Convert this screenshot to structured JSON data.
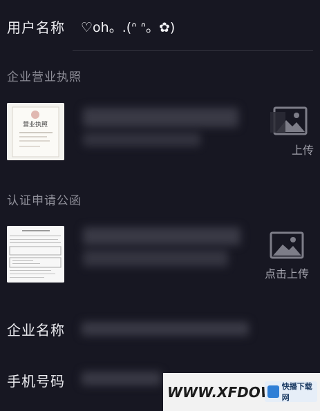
{
  "user": {
    "label": "用户名称",
    "value": "♡oh。.(ᐢ ᐢ。✿)"
  },
  "license": {
    "section_title": "企业营业执照",
    "thumb_text": "营业执照",
    "upload_label": "上传"
  },
  "letter": {
    "section_title": "认证申请公函",
    "upload_label": "点击上传"
  },
  "company": {
    "label": "企业名称"
  },
  "phone": {
    "label": "手机号码"
  },
  "watermark": {
    "text": "WWW.XFDOW",
    "badge": "快播下载网"
  },
  "icons": {
    "upload": "image-icon"
  }
}
